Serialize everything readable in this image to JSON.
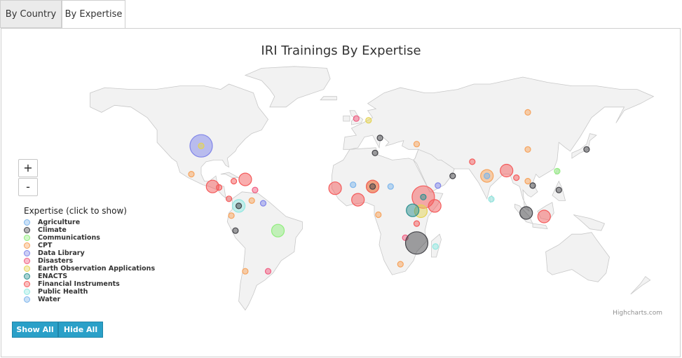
{
  "tabs": [
    {
      "label": "By Country",
      "active": false
    },
    {
      "label": "By Expertise",
      "active": true
    }
  ],
  "map_title": "IRI Trainings By Expertise",
  "zoom": {
    "in_label": "+",
    "out_label": "-"
  },
  "legend": {
    "title": "Expertise (click to show)",
    "items": [
      {
        "label": "Agriculture",
        "color": "#7cb5ec"
      },
      {
        "label": "Climate",
        "color": "#434348"
      },
      {
        "label": "Communications",
        "color": "#90ed7d"
      },
      {
        "label": "CPT",
        "color": "#f7a35c"
      },
      {
        "label": "Data Library",
        "color": "#8085e9"
      },
      {
        "label": "Disasters",
        "color": "#f15c80"
      },
      {
        "label": "Earth Observation Applications",
        "color": "#e4d354"
      },
      {
        "label": "ENACTS",
        "color": "#2b908f"
      },
      {
        "label": "Financial Instruments",
        "color": "#f45b5b"
      },
      {
        "label": "Public Health",
        "color": "#91e8e1"
      },
      {
        "label": "Water",
        "color": "#7cb5ec"
      }
    ]
  },
  "credits": "Highcharts.com",
  "buttons": {
    "show_all": "Show All",
    "hide_all": "Hide All"
  },
  "map_colors": {
    "land": "#f2f2f2",
    "border": "#c8c8c8"
  },
  "bubbles": [
    {
      "place": "United States",
      "lon": -97,
      "lat": 38,
      "expertise": "Data Library",
      "size": "large"
    },
    {
      "place": "United States",
      "lon": -97,
      "lat": 38,
      "expertise": "Earth Observation Applications",
      "size": "small"
    },
    {
      "place": "Mexico",
      "lon": -103,
      "lat": 22,
      "expertise": "CPT",
      "size": "small"
    },
    {
      "place": "Guatemala",
      "lon": -90,
      "lat": 15,
      "expertise": "Financial Instruments",
      "size": "medium"
    },
    {
      "place": "Honduras",
      "lon": -86,
      "lat": 14.5,
      "expertise": "Financial Instruments",
      "size": "small"
    },
    {
      "place": "Jamaica",
      "lon": -77,
      "lat": 18,
      "expertise": "Financial Instruments",
      "size": "small"
    },
    {
      "place": "Dominican Republic",
      "lon": -70,
      "lat": 19,
      "expertise": "Financial Instruments",
      "size": "medium"
    },
    {
      "place": "Caribbean",
      "lon": -64,
      "lat": 13,
      "expertise": "Disasters",
      "size": "small"
    },
    {
      "place": "Venezuela",
      "lon": -66,
      "lat": 7,
      "expertise": "CPT",
      "size": "small"
    },
    {
      "place": "Guyana",
      "lon": -59,
      "lat": 5.5,
      "expertise": "Data Library",
      "size": "small"
    },
    {
      "place": "Panama",
      "lon": -80,
      "lat": 8,
      "expertise": "Financial Instruments",
      "size": "small"
    },
    {
      "place": "Colombia",
      "lon": -74,
      "lat": 4,
      "expertise": "Public Health",
      "size": "medium"
    },
    {
      "place": "Colombia",
      "lon": -74,
      "lat": 4,
      "expertise": "Climate",
      "size": "small"
    },
    {
      "place": "Ecuador",
      "lon": -78.5,
      "lat": -1.5,
      "expertise": "CPT",
      "size": "small"
    },
    {
      "place": "Peru",
      "lon": -76,
      "lat": -10,
      "expertise": "Climate",
      "size": "small"
    },
    {
      "place": "Brazil",
      "lon": -50,
      "lat": -10,
      "expertise": "Communications",
      "size": "medium"
    },
    {
      "place": "Chile",
      "lon": -70,
      "lat": -33,
      "expertise": "CPT",
      "size": "small"
    },
    {
      "place": "Uruguay",
      "lon": -56,
      "lat": -33,
      "expertise": "Disasters",
      "size": "small"
    },
    {
      "place": "Senegal",
      "lon": -15,
      "lat": 14,
      "expertise": "Financial Instruments",
      "size": "medium"
    },
    {
      "place": "Mali",
      "lon": -4,
      "lat": 16,
      "expertise": "Agriculture",
      "size": "small"
    },
    {
      "place": "Ghana",
      "lon": -1,
      "lat": 7.5,
      "expertise": "Financial Instruments",
      "size": "medium"
    },
    {
      "place": "Niger",
      "lon": 8,
      "lat": 15,
      "expertise": "Earth Observation Applications",
      "size": "medium"
    },
    {
      "place": "Niger",
      "lon": 8,
      "lat": 15,
      "expertise": "Financial Instruments",
      "size": "medium"
    },
    {
      "place": "Niger",
      "lon": 8,
      "lat": 15,
      "expertise": "Climate",
      "size": "small"
    },
    {
      "place": "Chad",
      "lon": 19,
      "lat": 15,
      "expertise": "Agriculture",
      "size": "small"
    },
    {
      "place": "Ethiopia",
      "lon": 39,
      "lat": 9,
      "expertise": "Financial Instruments",
      "size": "large"
    },
    {
      "place": "Ethiopia",
      "lon": 39,
      "lat": 9,
      "expertise": "ENACTS",
      "size": "small"
    },
    {
      "place": "Kenya",
      "lon": 37.5,
      "lat": 1,
      "expertise": "Earth Observation Applications",
      "size": "medium"
    },
    {
      "place": "Somalia",
      "lon": 46,
      "lat": 4,
      "expertise": "Financial Instruments",
      "size": "medium"
    },
    {
      "place": "Uganda",
      "lon": 32.5,
      "lat": 1.5,
      "expertise": "ENACTS",
      "size": "medium"
    },
    {
      "place": "Tanzania",
      "lon": 35,
      "lat": -6,
      "expertise": "Financial Instruments",
      "size": "small"
    },
    {
      "place": "Zambia",
      "lon": 28,
      "lat": -14,
      "expertise": "Disasters",
      "size": "small"
    },
    {
      "place": "Mozambique",
      "lon": 35,
      "lat": -17,
      "expertise": "Climate",
      "size": "large"
    },
    {
      "place": "Madagascar",
      "lon": 46.5,
      "lat": -19,
      "expertise": "Public Health",
      "size": "small"
    },
    {
      "place": "South Africa",
      "lon": 25,
      "lat": -29,
      "expertise": "CPT",
      "size": "small"
    },
    {
      "place": "Gabon",
      "lon": 11.5,
      "lat": -1,
      "expertise": "CPT",
      "size": "small"
    },
    {
      "place": "Tunisia",
      "lon": 9.5,
      "lat": 34,
      "expertise": "Climate",
      "size": "small"
    },
    {
      "place": "Italy",
      "lon": 12.5,
      "lat": 42.5,
      "expertise": "Climate",
      "size": "small"
    },
    {
      "place": "Turkey",
      "lon": 35,
      "lat": 39,
      "expertise": "CPT",
      "size": "small"
    },
    {
      "place": "United Kingdom",
      "lon": -2,
      "lat": 53.5,
      "expertise": "Disasters",
      "size": "small"
    },
    {
      "place": "Netherlands",
      "lon": 5.5,
      "lat": 52.5,
      "expertise": "Earth Observation Applications",
      "size": "small"
    },
    {
      "place": "Yemen",
      "lon": 48,
      "lat": 15.5,
      "expertise": "Data Library",
      "size": "small"
    },
    {
      "place": "Oman",
      "lon": 57,
      "lat": 21,
      "expertise": "Climate",
      "size": "small"
    },
    {
      "place": "Pakistan",
      "lon": 69,
      "lat": 29,
      "expertise": "Financial Instruments",
      "size": "small"
    },
    {
      "place": "India",
      "lon": 78,
      "lat": 21,
      "expertise": "CPT",
      "size": "medium"
    },
    {
      "place": "India",
      "lon": 78,
      "lat": 21,
      "expertise": "Agriculture",
      "size": "small"
    },
    {
      "place": "Sri Lanka",
      "lon": 80.7,
      "lat": 7.8,
      "expertise": "Public Health",
      "size": "small"
    },
    {
      "place": "Bangladesh",
      "lon": 90,
      "lat": 24,
      "expertise": "Financial Instruments",
      "size": "medium"
    },
    {
      "place": "China",
      "lon": 103,
      "lat": 36,
      "expertise": "CPT",
      "size": "small"
    },
    {
      "place": "Mongolia",
      "lon": 103,
      "lat": 57,
      "expertise": "CPT",
      "size": "small"
    },
    {
      "place": "Myanmar",
      "lon": 96,
      "lat": 20,
      "expertise": "Financial Instruments",
      "size": "small"
    },
    {
      "place": "Laos",
      "lon": 103,
      "lat": 18,
      "expertise": "CPT",
      "size": "small"
    },
    {
      "place": "Vietnam",
      "lon": 106,
      "lat": 15.5,
      "expertise": "Climate",
      "size": "small"
    },
    {
      "place": "Philippines",
      "lon": 122,
      "lat": 13,
      "expertise": "Climate",
      "size": "small"
    },
    {
      "place": "Indonesia",
      "lon": 102,
      "lat": 0,
      "expertise": "Climate",
      "size": "medium"
    },
    {
      "place": "Indonesia",
      "lon": 113,
      "lat": -2,
      "expertise": "Financial Instruments",
      "size": "medium"
    },
    {
      "place": "Taiwan",
      "lon": 121,
      "lat": 23.7,
      "expertise": "Communications",
      "size": "small"
    },
    {
      "place": "Japan",
      "lon": 139,
      "lat": 36,
      "expertise": "Climate",
      "size": "small"
    }
  ]
}
